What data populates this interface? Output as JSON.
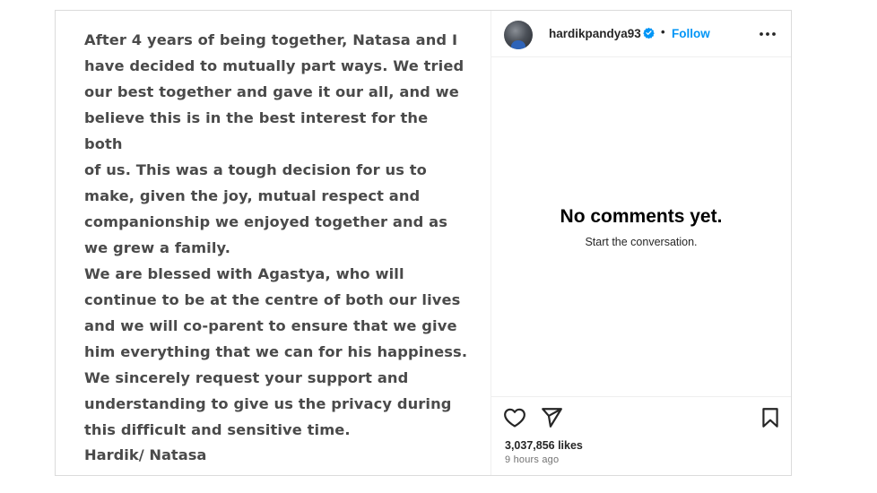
{
  "post": {
    "statement_lines": [
      "After 4 years of being together, Natasa and I",
      "have decided to mutually part ways. We tried",
      "our best together and gave it our all, and we",
      "believe this is in the best interest for the both",
      "of us. This was a tough decision for us to",
      "make, given the joy, mutual respect and",
      "companionship we enjoyed together and as",
      "we grew a family.",
      "We are blessed with Agastya, who will",
      "continue to be at the centre of both our lives",
      "and we will co-parent to ensure that we give",
      "him everything that we can for his happiness.",
      "We sincerely request your support and",
      "understanding to give us the privacy during",
      "this difficult and sensitive time."
    ],
    "signature": "Hardik/ Natasa"
  },
  "header": {
    "username": "hardikpandya93",
    "separator": "•",
    "follow_label": "Follow",
    "verified_icon": "verified-badge-icon",
    "more_icon": "more-options-icon"
  },
  "comments": {
    "empty_title": "No comments yet.",
    "empty_subtitle": "Start the conversation."
  },
  "actions": {
    "like_icon": "heart-icon",
    "share_icon": "paper-plane-icon",
    "save_icon": "bookmark-icon",
    "likes_text": "3,037,856 likes",
    "timestamp": "9 hours ago"
  },
  "colors": {
    "accent": "#0095f6",
    "border": "#dbdbdb",
    "statement_text": "#4a4a4a"
  }
}
